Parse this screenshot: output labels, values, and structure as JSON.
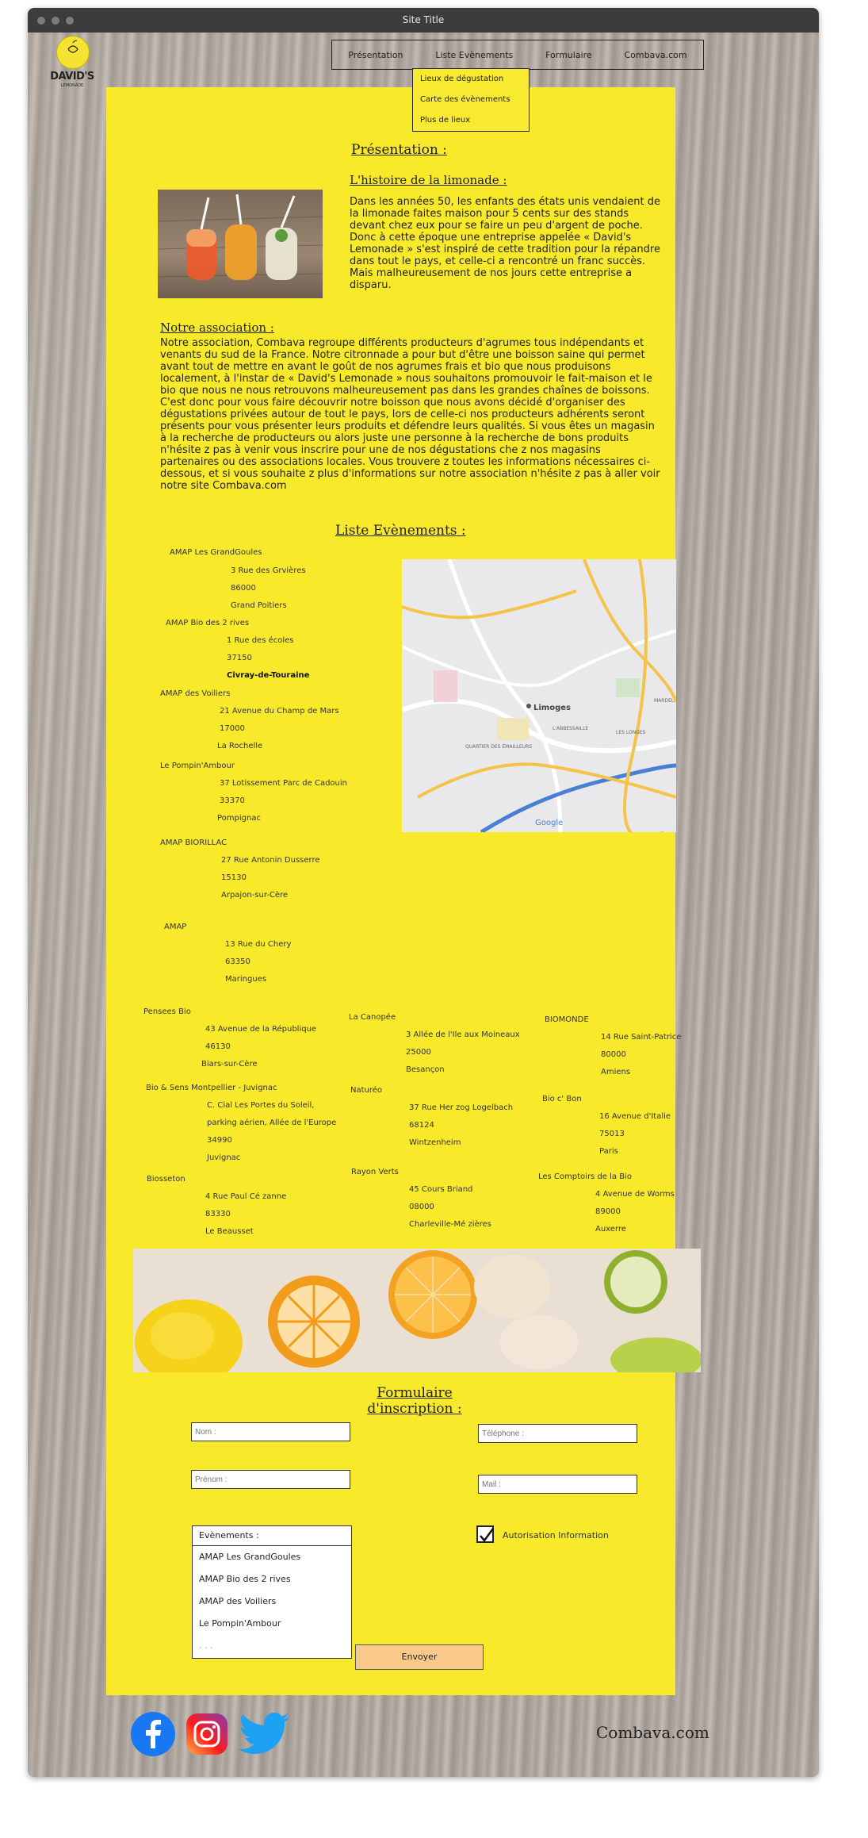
{
  "window": {
    "title": "Site Title"
  },
  "logo": {
    "text": "DAVID'S",
    "sub": "LEMONADE"
  },
  "nav": {
    "items": [
      "Présentation",
      "Liste Evènements",
      "Formulaire",
      "Combava.com"
    ],
    "dropdown": [
      "Lieux de dégustation",
      "Carte des évènements",
      "Plus de lieux"
    ]
  },
  "presentation": {
    "title": "Présentation :",
    "history_title": "L'histoire de la limonade :",
    "history_text": "Dans les années 50, les enfants des états unis vendaient de la limonade faites maison pour 5 cents sur des stands devant chez eux pour se faire un peu d'argent de poche. Donc à cette époque une entreprise appelée « David's Lemonade » s'est inspiré de cette tradition pour la répandre dans tout le pays, et celle-ci a rencontré un franc succès. Mais malheureusement de nos jours cette entreprise a disparu.",
    "assoc_title": "Notre association :",
    "assoc_text": "Notre association, Combava regroupe différents producteurs d'agrumes tous indépendants et venants du sud de la France. Notre citronnade a pour but d'être une boisson saine qui permet avant tout de mettre en avant le goût de nos agrumes frais et bio que nous produisons localement, à l'instar de « David's Lemonade » nous souhaitons promouvoir le fait-maison et le bio que nous ne nous retrouvons malheureusement pas dans les grandes chaînes de boissons. C'est donc pour vous faire découvrir notre boisson que nous avons décidé d'organiser des dégustations privées autour de tout le pays, lors de celle-ci nos producteurs adhérents seront présents pour vous présenter leurs produits et défendre leurs qualités. Si vous êtes un magasin à la recherche de producteurs ou alors juste une personne à la recherche de bons produits n'hésite z pas à venir vous inscrire pour une de nos dégustations che z nos magasins partenaires ou des associations locales. Vous trouvere z toutes les informations nécessaires ci-dessous, et si vous souhaite z plus d'informations sur notre association n'hésite z pas à aller voir notre site Combava.com"
  },
  "events": {
    "title": "Liste Evènements :",
    "list": [
      {
        "name": "AMAP Les GrandGoules",
        "street": "3 Rue des Grvières",
        "zip": "86000",
        "city": "Grand Poitiers"
      },
      {
        "name": "AMAP Bio des 2 rives",
        "street": "1 Rue des écoles",
        "zip": "37150",
        "city": "Civray-de-Touraine"
      },
      {
        "name": "AMAP des Voiliers",
        "street": "21 Avenue du Champ de Mars",
        "zip": "17000",
        "city": "La Rochelle"
      },
      {
        "name": "Le Pompin'Ambour",
        "street": "37 Lotissement Parc de Cadouin",
        "zip": "33370",
        "city": "Pompignac"
      },
      {
        "name": "AMAP BIORILLAC",
        "street": "27 Rue Antonin Dusserre",
        "zip": "15130",
        "city": "Arpajon-sur-Cère"
      },
      {
        "name": "AMAP",
        "street": "13 Rue du Chery",
        "zip": "63350",
        "city": "Maringues"
      }
    ],
    "col1": [
      {
        "name": "Pensees Bio",
        "street": "43 Avenue de la République",
        "zip": "46130",
        "city": "Biars-sur-Cère"
      },
      {
        "name": "Bio & Sens Montpellier - Juvignac",
        "street": "C. Cial Les Portes du Soleil,",
        "street2": "parking aérien, Allée de l'Europe",
        "zip": "34990",
        "city": "Juvignac"
      },
      {
        "name": "Biosseton",
        "street": "4 Rue Paul Cé zanne",
        "zip": "83330",
        "city": "Le Beausset"
      }
    ],
    "col2": [
      {
        "name": "La Canopée",
        "street": "3 Allée de l'Ile aux Moineaux",
        "zip": "25000",
        "city": "Besançon"
      },
      {
        "name": "Naturéo",
        "street": "37 Rue Her zog Logelbach",
        "zip": "68124",
        "city": "Wintzenheim"
      },
      {
        "name": "Rayon Verts",
        "street": "45 Cours Briand",
        "zip": "08000",
        "city": "Charleville-Mé zières"
      }
    ],
    "col3": [
      {
        "name": "BIOMONDE",
        "street": "14 Rue Saint-Patrice",
        "zip": "80000",
        "city": "Amiens"
      },
      {
        "name": "Bio c' Bon",
        "street": "16 Avenue d'Italie",
        "zip": "75013",
        "city": "Paris"
      },
      {
        "name": "Les Comptoirs de la Bio",
        "street": "4 Avenue de Worms",
        "zip": "89000",
        "city": "Auxerre"
      }
    ],
    "map": {
      "city_label": "Limoges",
      "district1": "QUARTIER DES ÉMAILLEURS",
      "district2": "L'ABBESSAILLE",
      "district3": "LES LONGES",
      "district4": "MARDEL",
      "brand": "Google"
    }
  },
  "form": {
    "title_line1": "Formulaire",
    "title_line2": "d'inscription :",
    "nom_placeholder": "Nom :",
    "prenom_placeholder": "Prénom :",
    "telephone_placeholder": "Téléphone :",
    "mail_placeholder": "Mail :",
    "events_label": "Evènements :",
    "events_options": [
      "AMAP Les GrandGoules",
      "AMAP Bio des 2 rives",
      "AMAP des Voiliers",
      "Le Pompin'Ambour",
      ". . ."
    ],
    "checkbox_label": "Autorisation Information",
    "submit": "Envoyer"
  },
  "footer": {
    "brand": "Combava.com"
  },
  "colors": {
    "main_bg": "#f8e92b",
    "facebook": "#1877f2",
    "twitter": "#1da1f2",
    "submit": "#f8c98a"
  }
}
